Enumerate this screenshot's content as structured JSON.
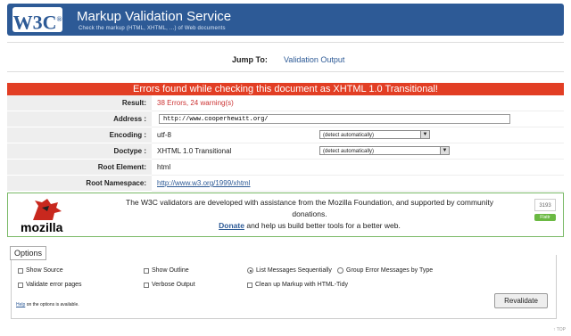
{
  "header": {
    "logo": "W3C",
    "title": "Markup Validation Service",
    "subtitle": "Check the markup (HTML, XHTML, ...) of Web documents"
  },
  "jump": {
    "label": "Jump To:",
    "link": "Validation Output"
  },
  "error_header": "Errors found while checking this document as XHTML 1.0 Transitional!",
  "results": {
    "result_label": "Result:",
    "result_value": "38 Errors, 24 warning(s)",
    "address_label": "Address :",
    "address_value": "http://www.cooperhewitt.org/",
    "encoding_label": "Encoding :",
    "encoding_value": "utf-8",
    "encoding_select": "(detect automatically)",
    "doctype_label": "Doctype :",
    "doctype_value": "XHTML 1.0 Transitional",
    "doctype_select": "(detect automatically)",
    "root_element_label": "Root Element:",
    "root_element_value": "html",
    "root_namespace_label": "Root Namespace:",
    "root_namespace_value": "http://www.w3.org/1999/xhtml"
  },
  "mozilla": {
    "wordmark": "mozilla",
    "text_line1": "The W3C validators are developed with assistance from the Mozilla Foundation, and supported by community donations.",
    "donate": "Donate",
    "text_line2_rest": "and help us build better tools for a better web.",
    "flattr_count": "3193",
    "flattr_label": "Flattr"
  },
  "options": {
    "legend": "Options",
    "show_source": "Show Source",
    "show_outline": "Show Outline",
    "list_sequential": "List Messages Sequentially",
    "group_by_type": "Group Error Messages by Type",
    "validate_error_pages": "Validate error pages",
    "verbose_output": "Verbose Output",
    "clean_up": "Clean up Markup with HTML-Tidy",
    "help_link": "Help",
    "help_rest": "on the options is available.",
    "revalidate": "Revalidate"
  },
  "top_link": "↑ TOP"
}
